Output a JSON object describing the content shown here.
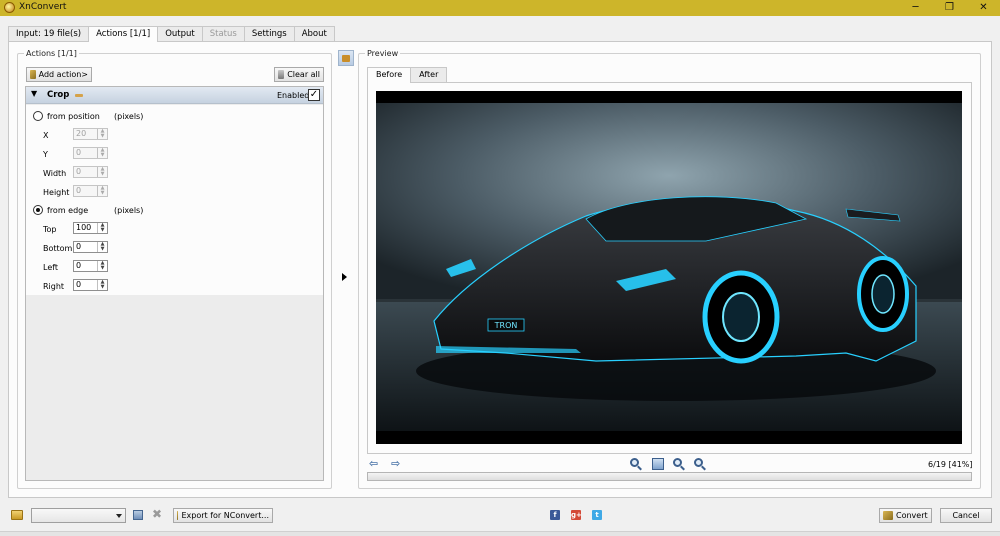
{
  "window": {
    "title": "XnConvert",
    "controls": {
      "minimize": "─",
      "maximize": "❐",
      "close": "✕"
    }
  },
  "tabs": [
    {
      "label": "Input: 19 file(s)"
    },
    {
      "label": "Actions [1/1]",
      "active": true
    },
    {
      "label": "Output"
    },
    {
      "label": "Status",
      "disabled": true
    },
    {
      "label": "Settings"
    },
    {
      "label": "About"
    }
  ],
  "actions_panel": {
    "title": "Actions [1/1]",
    "add_action_label": "Add action>",
    "clear_all_label": "Clear all",
    "crop": {
      "name": "Crop",
      "enabled_label": "Enabled",
      "enabled": true,
      "from_position_label": "from position",
      "from_position_unit": "(pixels)",
      "x_label": "X",
      "x_value": "20",
      "y_label": "Y",
      "y_value": "0",
      "width_label": "Width",
      "width_value": "0",
      "height_label": "Height",
      "height_value": "0",
      "from_edge_label": "from edge",
      "from_edge_unit": "(pixels)",
      "top_label": "Top",
      "top_value": "100",
      "bottom_label": "Bottom",
      "bottom_value": "0",
      "left_label": "Left",
      "left_value": "0",
      "right_label": "Right",
      "right_value": "0",
      "mode": "from edge"
    }
  },
  "preview_panel": {
    "title": "Preview",
    "tabs": [
      {
        "label": "Before",
        "active": true
      },
      {
        "label": "After"
      }
    ],
    "image_label": "TRON",
    "counter": "6/19 [41%]"
  },
  "bottom_bar": {
    "preset_value": "",
    "export_label": "Export for NConvert...",
    "convert_label": "Convert",
    "cancel_label": "Cancel",
    "social": {
      "facebook": "f",
      "google_plus": "g+",
      "twitter": "t"
    }
  },
  "colors": {
    "title_bar": "#cdb52a",
    "crop_header": "#c6d2e0",
    "neon_accent": "#28d0ff"
  }
}
